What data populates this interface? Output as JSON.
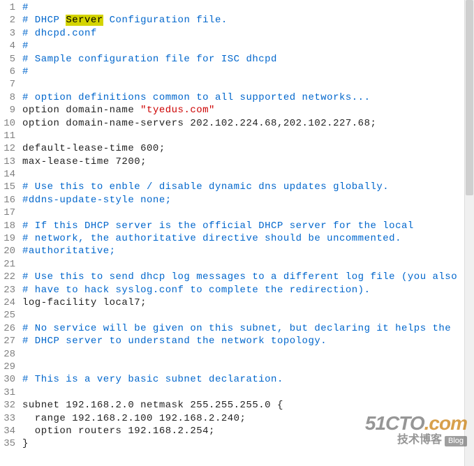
{
  "lines": [
    {
      "num": 1,
      "segments": [
        {
          "cls": "comment",
          "text": "#"
        }
      ]
    },
    {
      "num": 2,
      "segments": [
        {
          "cls": "comment",
          "text": "# DHCP "
        },
        {
          "cls": "highlight",
          "text": "Server"
        },
        {
          "cls": "comment",
          "text": " Configuration file."
        }
      ]
    },
    {
      "num": 3,
      "segments": [
        {
          "cls": "comment",
          "text": "# dhcpd.conf"
        }
      ]
    },
    {
      "num": 4,
      "segments": [
        {
          "cls": "comment",
          "text": "#"
        }
      ]
    },
    {
      "num": 5,
      "segments": [
        {
          "cls": "comment",
          "text": "# Sample configuration file for ISC dhcpd"
        }
      ]
    },
    {
      "num": 6,
      "segments": [
        {
          "cls": "comment",
          "text": "#"
        }
      ]
    },
    {
      "num": 7,
      "segments": []
    },
    {
      "num": 8,
      "segments": [
        {
          "cls": "comment",
          "text": "# option definitions common to all supported networks..."
        }
      ]
    },
    {
      "num": 9,
      "segments": [
        {
          "cls": "plain",
          "text": "option domain-name "
        },
        {
          "cls": "string",
          "text": "\"tyedus.com\""
        }
      ]
    },
    {
      "num": 10,
      "segments": [
        {
          "cls": "plain",
          "text": "option domain-name-servers 202.102.224.68,202.102.227.68;"
        }
      ]
    },
    {
      "num": 11,
      "segments": []
    },
    {
      "num": 12,
      "segments": [
        {
          "cls": "plain",
          "text": "default-lease-time 600;"
        }
      ]
    },
    {
      "num": 13,
      "segments": [
        {
          "cls": "plain",
          "text": "max-lease-time 7200;"
        }
      ]
    },
    {
      "num": 14,
      "segments": []
    },
    {
      "num": 15,
      "segments": [
        {
          "cls": "comment",
          "text": "# Use this to enble / disable dynamic dns updates globally."
        }
      ]
    },
    {
      "num": 16,
      "segments": [
        {
          "cls": "comment",
          "text": "#ddns-update-style none;"
        }
      ]
    },
    {
      "num": 17,
      "segments": []
    },
    {
      "num": 18,
      "segments": [
        {
          "cls": "comment",
          "text": "# If this DHCP server is the official DHCP server for the local"
        }
      ]
    },
    {
      "num": 19,
      "segments": [
        {
          "cls": "comment",
          "text": "# network, the authoritative directive should be uncommented."
        }
      ]
    },
    {
      "num": 20,
      "segments": [
        {
          "cls": "comment",
          "text": "#authoritative;"
        }
      ]
    },
    {
      "num": 21,
      "segments": []
    },
    {
      "num": 22,
      "segments": [
        {
          "cls": "comment",
          "text": "# Use this to send dhcp log messages to a different log file (you also"
        }
      ]
    },
    {
      "num": 23,
      "segments": [
        {
          "cls": "comment",
          "text": "# have to hack syslog.conf to complete the redirection)."
        }
      ]
    },
    {
      "num": 24,
      "segments": [
        {
          "cls": "plain",
          "text": "log-facility local7;"
        }
      ]
    },
    {
      "num": 25,
      "segments": []
    },
    {
      "num": 26,
      "segments": [
        {
          "cls": "comment",
          "text": "# No service will be given on this subnet, but declaring it helps the"
        }
      ]
    },
    {
      "num": 27,
      "segments": [
        {
          "cls": "comment",
          "text": "# DHCP server to understand the network topology."
        }
      ]
    },
    {
      "num": 28,
      "segments": []
    },
    {
      "num": 29,
      "segments": []
    },
    {
      "num": 30,
      "segments": [
        {
          "cls": "comment",
          "text": "# This is a very basic subnet declaration."
        }
      ]
    },
    {
      "num": 31,
      "segments": []
    },
    {
      "num": 32,
      "segments": [
        {
          "cls": "plain",
          "text": "subnet 192.168.2.0 netmask 255.255.255.0 {"
        }
      ]
    },
    {
      "num": 33,
      "segments": [
        {
          "cls": "plain",
          "text": "  range 192.168.2.100 192.168.2.240;"
        }
      ]
    },
    {
      "num": 34,
      "segments": [
        {
          "cls": "plain",
          "text": "  option routers 192.168.2.254;"
        }
      ]
    },
    {
      "num": 35,
      "segments": [
        {
          "cls": "plain",
          "text": "}"
        }
      ]
    }
  ],
  "watermark": {
    "top_left": "51CTO",
    "top_right": ".com",
    "bottom": "技术博客",
    "badge": "Blog"
  }
}
